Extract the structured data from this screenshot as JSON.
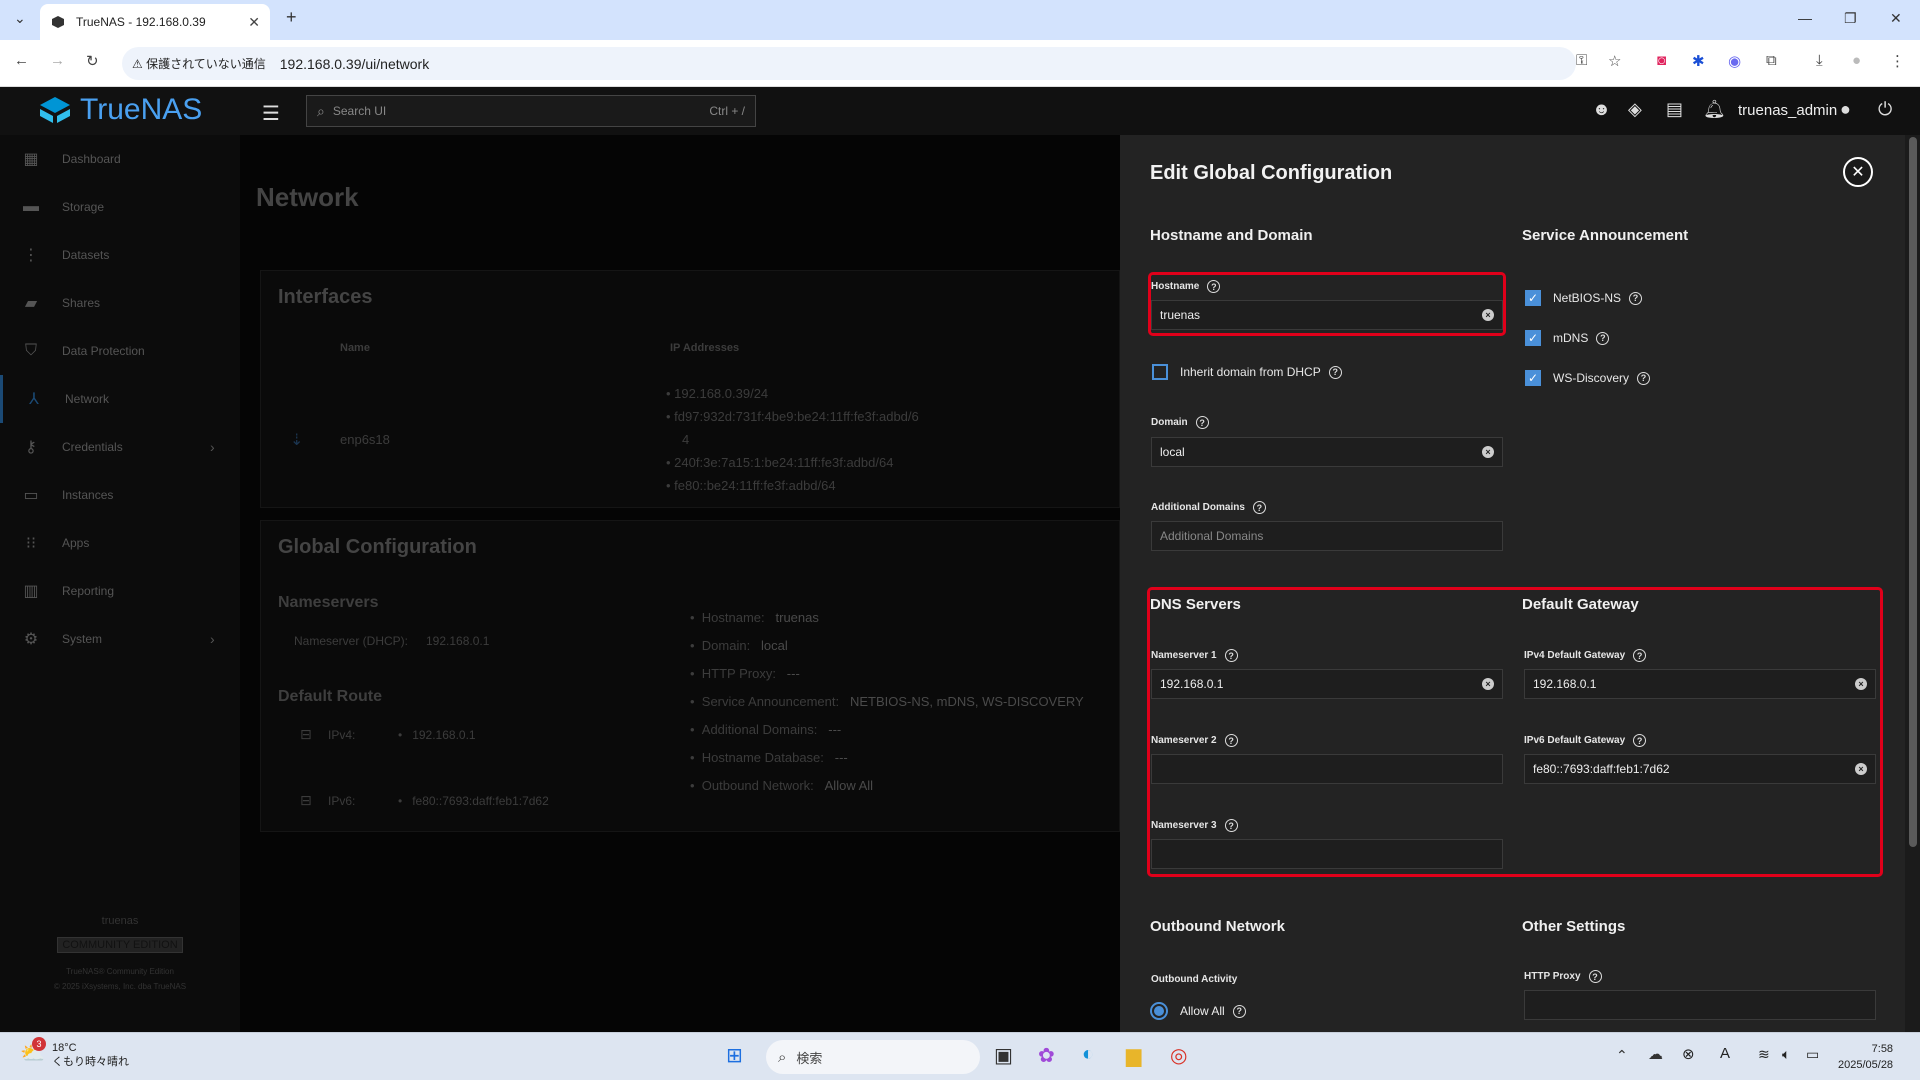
{
  "browser": {
    "tab_title": "TrueNAS - 192.168.0.39",
    "tab_close": "✕",
    "new_tab": "+",
    "security_warning": "保護されていない通信",
    "url": "192.168.0.39/ui/network",
    "window_controls": [
      "—",
      "❐",
      "✕"
    ]
  },
  "topbar": {
    "brand": "TrueNAS",
    "search_placeholder": "Search UI",
    "search_shortcut": "Ctrl + /",
    "username": "truenas_admin"
  },
  "sidebar": {
    "items": [
      {
        "label": "Dashboard",
        "icon": "dashboard-icon"
      },
      {
        "label": "Storage",
        "icon": "storage-icon"
      },
      {
        "label": "Datasets",
        "icon": "datasets-icon"
      },
      {
        "label": "Shares",
        "icon": "shares-icon"
      },
      {
        "label": "Data Protection",
        "icon": "shield-icon"
      },
      {
        "label": "Network",
        "icon": "network-icon"
      },
      {
        "label": "Credentials",
        "icon": "key-icon"
      },
      {
        "label": "Instances",
        "icon": "laptop-icon"
      },
      {
        "label": "Apps",
        "icon": "apps-grid-icon"
      },
      {
        "label": "Reporting",
        "icon": "chart-icon"
      },
      {
        "label": "System",
        "icon": "gear-icon"
      }
    ],
    "footer_host": "truenas",
    "footer_edition": "COMMUNITY EDITION",
    "footer_line1": "TrueNAS® Community Edition",
    "footer_line2": "© 2025 iXsystems, Inc. dba TrueNAS"
  },
  "main": {
    "page_title": "Network",
    "interfaces": {
      "title": "Interfaces",
      "col_name": "Name",
      "col_ip": "IP Addresses",
      "iface_name": "enp6s18",
      "ips": [
        "192.168.0.39/24",
        "fd97:932d:731f:4be9:be24:11ff:fe3f:adbd/6",
        "4",
        "240f:3e:7a15:1:be24:11ff:fe3f:adbd/64",
        "fe80::be24:11ff:fe3f:adbd/64"
      ]
    },
    "global": {
      "title": "Global Configuration",
      "nameservers_title": "Nameservers",
      "ns_dhcp_label": "Nameserver (DHCP):",
      "ns_dhcp_value": "192.168.0.1",
      "route_title": "Default Route",
      "ipv4_label": "IPv4:",
      "ipv4_value": "192.168.0.1",
      "ipv6_label": "IPv6:",
      "ipv6_value": "fe80::7693:daff:feb1:7d62",
      "details": [
        {
          "label": "Hostname:",
          "value": "truenas"
        },
        {
          "label": "Domain:",
          "value": "local"
        },
        {
          "label": "HTTP Proxy:",
          "value": "---"
        },
        {
          "label": "Service Announcement:",
          "value": "NETBIOS-NS, mDNS, WS-DISCOVERY"
        },
        {
          "label": "Additional Domains:",
          "value": "---"
        },
        {
          "label": "Hostname Database:",
          "value": "---"
        },
        {
          "label": "Outbound Network:",
          "value": "Allow All"
        }
      ]
    }
  },
  "panel": {
    "title": "Edit Global Configuration",
    "hostname_domain": "Hostname and Domain",
    "hostname_label": "Hostname",
    "hostname_value": "truenas",
    "inherit_label": "Inherit domain from DHCP",
    "domain_label": "Domain",
    "domain_value": "local",
    "additional_label": "Additional Domains",
    "additional_placeholder": "Additional Domains",
    "service_title": "Service Announcement",
    "netbios": "NetBIOS-NS",
    "mdns": "mDNS",
    "wsd": "WS-Discovery",
    "dns_title": "DNS Servers",
    "ns1_label": "Nameserver 1",
    "ns1_value": "192.168.0.1",
    "ns2_label": "Nameserver 2",
    "ns3_label": "Nameserver 3",
    "gw_title": "Default Gateway",
    "ipv4gw_label": "IPv4 Default Gateway",
    "ipv4gw_value": "192.168.0.1",
    "ipv6gw_label": "IPv6 Default Gateway",
    "ipv6gw_value": "fe80::7693:daff:feb1:7d62",
    "outbound_title": "Outbound Network",
    "outbound_activity": "Outbound Activity",
    "allow_all": "Allow All",
    "other_title": "Other Settings",
    "http_proxy_label": "HTTP Proxy"
  },
  "taskbar": {
    "temp": "18°C",
    "weather": "くもり時々晴れ",
    "weather_badge": "3",
    "search_label": "検索",
    "time": "7:58",
    "date": "2025/05/28"
  },
  "colors": {
    "accent": "#4a90d9",
    "highlight": "#e0001a",
    "brand": "#4aa0f0"
  }
}
